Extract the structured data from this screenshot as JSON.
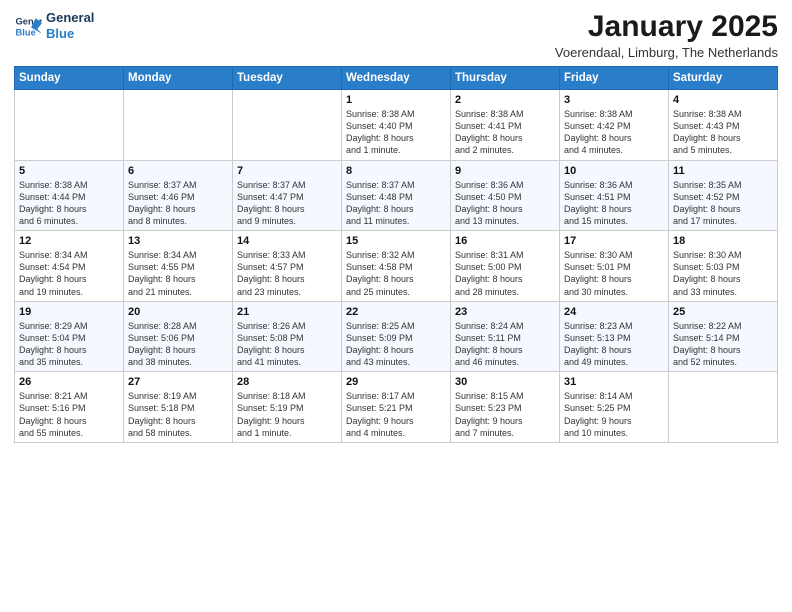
{
  "logo": {
    "line1": "General",
    "line2": "Blue"
  },
  "title": "January 2025",
  "location": "Voerendaal, Limburg, The Netherlands",
  "weekdays": [
    "Sunday",
    "Monday",
    "Tuesday",
    "Wednesday",
    "Thursday",
    "Friday",
    "Saturday"
  ],
  "weeks": [
    [
      {
        "day": "",
        "info": ""
      },
      {
        "day": "",
        "info": ""
      },
      {
        "day": "",
        "info": ""
      },
      {
        "day": "1",
        "info": "Sunrise: 8:38 AM\nSunset: 4:40 PM\nDaylight: 8 hours\nand 1 minute."
      },
      {
        "day": "2",
        "info": "Sunrise: 8:38 AM\nSunset: 4:41 PM\nDaylight: 8 hours\nand 2 minutes."
      },
      {
        "day": "3",
        "info": "Sunrise: 8:38 AM\nSunset: 4:42 PM\nDaylight: 8 hours\nand 4 minutes."
      },
      {
        "day": "4",
        "info": "Sunrise: 8:38 AM\nSunset: 4:43 PM\nDaylight: 8 hours\nand 5 minutes."
      }
    ],
    [
      {
        "day": "5",
        "info": "Sunrise: 8:38 AM\nSunset: 4:44 PM\nDaylight: 8 hours\nand 6 minutes."
      },
      {
        "day": "6",
        "info": "Sunrise: 8:37 AM\nSunset: 4:46 PM\nDaylight: 8 hours\nand 8 minutes."
      },
      {
        "day": "7",
        "info": "Sunrise: 8:37 AM\nSunset: 4:47 PM\nDaylight: 8 hours\nand 9 minutes."
      },
      {
        "day": "8",
        "info": "Sunrise: 8:37 AM\nSunset: 4:48 PM\nDaylight: 8 hours\nand 11 minutes."
      },
      {
        "day": "9",
        "info": "Sunrise: 8:36 AM\nSunset: 4:50 PM\nDaylight: 8 hours\nand 13 minutes."
      },
      {
        "day": "10",
        "info": "Sunrise: 8:36 AM\nSunset: 4:51 PM\nDaylight: 8 hours\nand 15 minutes."
      },
      {
        "day": "11",
        "info": "Sunrise: 8:35 AM\nSunset: 4:52 PM\nDaylight: 8 hours\nand 17 minutes."
      }
    ],
    [
      {
        "day": "12",
        "info": "Sunrise: 8:34 AM\nSunset: 4:54 PM\nDaylight: 8 hours\nand 19 minutes."
      },
      {
        "day": "13",
        "info": "Sunrise: 8:34 AM\nSunset: 4:55 PM\nDaylight: 8 hours\nand 21 minutes."
      },
      {
        "day": "14",
        "info": "Sunrise: 8:33 AM\nSunset: 4:57 PM\nDaylight: 8 hours\nand 23 minutes."
      },
      {
        "day": "15",
        "info": "Sunrise: 8:32 AM\nSunset: 4:58 PM\nDaylight: 8 hours\nand 25 minutes."
      },
      {
        "day": "16",
        "info": "Sunrise: 8:31 AM\nSunset: 5:00 PM\nDaylight: 8 hours\nand 28 minutes."
      },
      {
        "day": "17",
        "info": "Sunrise: 8:30 AM\nSunset: 5:01 PM\nDaylight: 8 hours\nand 30 minutes."
      },
      {
        "day": "18",
        "info": "Sunrise: 8:30 AM\nSunset: 5:03 PM\nDaylight: 8 hours\nand 33 minutes."
      }
    ],
    [
      {
        "day": "19",
        "info": "Sunrise: 8:29 AM\nSunset: 5:04 PM\nDaylight: 8 hours\nand 35 minutes."
      },
      {
        "day": "20",
        "info": "Sunrise: 8:28 AM\nSunset: 5:06 PM\nDaylight: 8 hours\nand 38 minutes."
      },
      {
        "day": "21",
        "info": "Sunrise: 8:26 AM\nSunset: 5:08 PM\nDaylight: 8 hours\nand 41 minutes."
      },
      {
        "day": "22",
        "info": "Sunrise: 8:25 AM\nSunset: 5:09 PM\nDaylight: 8 hours\nand 43 minutes."
      },
      {
        "day": "23",
        "info": "Sunrise: 8:24 AM\nSunset: 5:11 PM\nDaylight: 8 hours\nand 46 minutes."
      },
      {
        "day": "24",
        "info": "Sunrise: 8:23 AM\nSunset: 5:13 PM\nDaylight: 8 hours\nand 49 minutes."
      },
      {
        "day": "25",
        "info": "Sunrise: 8:22 AM\nSunset: 5:14 PM\nDaylight: 8 hours\nand 52 minutes."
      }
    ],
    [
      {
        "day": "26",
        "info": "Sunrise: 8:21 AM\nSunset: 5:16 PM\nDaylight: 8 hours\nand 55 minutes."
      },
      {
        "day": "27",
        "info": "Sunrise: 8:19 AM\nSunset: 5:18 PM\nDaylight: 8 hours\nand 58 minutes."
      },
      {
        "day": "28",
        "info": "Sunrise: 8:18 AM\nSunset: 5:19 PM\nDaylight: 9 hours\nand 1 minute."
      },
      {
        "day": "29",
        "info": "Sunrise: 8:17 AM\nSunset: 5:21 PM\nDaylight: 9 hours\nand 4 minutes."
      },
      {
        "day": "30",
        "info": "Sunrise: 8:15 AM\nSunset: 5:23 PM\nDaylight: 9 hours\nand 7 minutes."
      },
      {
        "day": "31",
        "info": "Sunrise: 8:14 AM\nSunset: 5:25 PM\nDaylight: 9 hours\nand 10 minutes."
      },
      {
        "day": "",
        "info": ""
      }
    ]
  ]
}
